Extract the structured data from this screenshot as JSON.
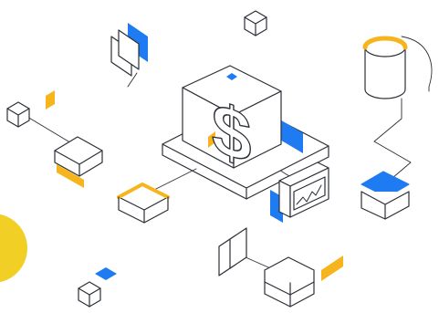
{
  "illustration": {
    "central_symbol": "$",
    "colors": {
      "stroke": "#2b2f36",
      "blue": "#1f7bf2",
      "yellow": "#f7b51d",
      "yellow_circle": "#f2cf24",
      "fill": "#ffffff"
    },
    "icons": [
      "dollar-cube-icon",
      "chart-monitor-icon",
      "database-cylinder-icon",
      "stacked-cubes-icon",
      "pane-layers-icon"
    ]
  }
}
